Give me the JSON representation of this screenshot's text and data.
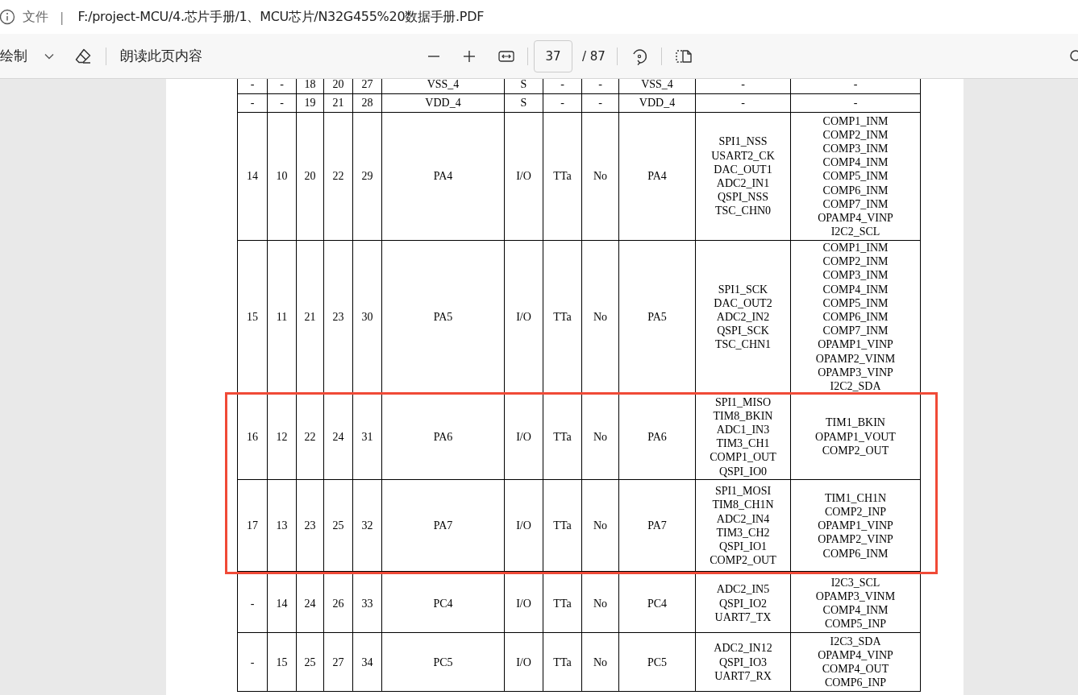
{
  "address_bar": {
    "label": "文件",
    "separator": "|",
    "url": "F:/project-MCU/4.芯片手册/1、MCU芯片/N32G455%20数据手册.PDF"
  },
  "toolbar": {
    "draw_label": "绘制",
    "read_aloud": "朗读此页内容",
    "page_number": "37",
    "page_total": "/ 87"
  },
  "document": {
    "sections": [
      {
        "rows": [
          {
            "highlighted": false,
            "cells": [
              "-",
              "-",
              "18",
              "20",
              "27",
              "VSS_4",
              "S",
              "-",
              "-",
              "VSS_4",
              "-",
              "-"
            ]
          },
          {
            "highlighted": false,
            "cells": [
              "-",
              "-",
              "19",
              "21",
              "28",
              "VDD_4",
              "S",
              "-",
              "-",
              "VDD_4",
              "-",
              "-"
            ]
          },
          {
            "highlighted": false,
            "cells": [
              "14",
              "10",
              "20",
              "22",
              "29",
              "PA4",
              "I/O",
              "TTa",
              "No",
              "PA4",
              "SPI1_NSS\nUSART2_CK\nDAC_OUT1\nADC2_IN1\nQSPI_NSS\nTSC_CHN0",
              "COMP1_INM\nCOMP2_INM\nCOMP3_INM\nCOMP4_INM\nCOMP5_INM\nCOMP6_INM\nCOMP7_INM\nOPAMP4_VINP\nI2C2_SCL"
            ]
          },
          {
            "highlighted": false,
            "cells": [
              "15",
              "11",
              "21",
              "23",
              "30",
              "PA5",
              "I/O",
              "TTa",
              "No",
              "PA5",
              "SPI1_SCK\nDAC_OUT2\nADC2_IN2\nQSPI_SCK\nTSC_CHN1",
              "COMP1_INM\nCOMP2_INM\nCOMP3_INM\nCOMP4_INM\nCOMP5_INM\nCOMP6_INM\nCOMP7_INM\nOPAMP1_VINP\nOPAMP2_VINM\nOPAMP3_VINP\nI2C2_SDA"
            ]
          },
          {
            "highlighted": true,
            "cells": [
              "16",
              "12",
              "22",
              "24",
              "31",
              "PA6",
              "I/O",
              "TTa",
              "No",
              "PA6",
              "SPI1_MISO\nTIM8_BKIN\nADC1_IN3\nTIM3_CH1\nCOMP1_OUT\nQSPI_IO0",
              "TIM1_BKIN\nOPAMP1_VOUT\nCOMP2_OUT"
            ]
          },
          {
            "highlighted": true,
            "cells": [
              "17",
              "13",
              "23",
              "25",
              "32",
              "PA7",
              "I/O",
              "TTa",
              "No",
              "PA7",
              "SPI1_MOSI\nTIM8_CH1N\nADC2_IN4\nTIM3_CH2\nQSPI_IO1\nCOMP2_OUT",
              "TIM1_CH1N\nCOMP2_INP\nOPAMP1_VINP\nOPAMP2_VINP\nCOMP6_INM"
            ]
          }
        ]
      },
      {
        "rows": [
          {
            "highlighted": false,
            "cells": [
              "-",
              "14",
              "24",
              "26",
              "33",
              "PC4",
              "I/O",
              "TTa",
              "No",
              "PC4",
              "ADC2_IN5\nQSPI_IO2\nUART7_TX",
              "I2C3_SCL\nOPAMP3_VINM\nCOMP4_INM\nCOMP5_INP"
            ]
          },
          {
            "highlighted": false,
            "cells": [
              "-",
              "15",
              "25",
              "27",
              "34",
              "PC5",
              "I/O",
              "TTa",
              "No",
              "PC5",
              "ADC2_IN12\nQSPI_IO3\nUART7_RX",
              "I2C3_SDA\nOPAMP4_VINP\nCOMP4_OUT\nCOMP6_INP"
            ]
          }
        ]
      }
    ]
  }
}
